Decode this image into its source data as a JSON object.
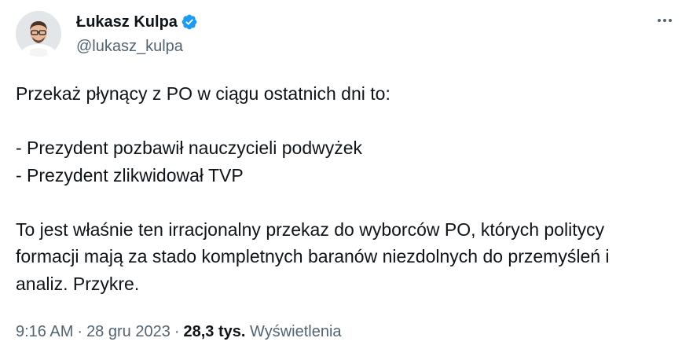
{
  "author": {
    "name": "Łukasz Kulpa",
    "handle": "@lukasz_kulpa",
    "verified": true,
    "verified_color": "#1d9bf0"
  },
  "tweet": {
    "lines": [
      "Przekaż płynący z PO w ciągu ostatnich dni to:",
      "",
      "- Prezydent pozbawił nauczycieli podwyżek",
      "- Prezydent zlikwidował TVP",
      "",
      "To jest właśnie ten irracjonalny przekaz do wyborców PO, których politycy",
      "formacji mają za stado kompletnych baranów niezdolnych do przemyśleń i",
      "analiz. Przykre."
    ]
  },
  "meta": {
    "time": "9:16 AM",
    "separator": "·",
    "date": "28 gru 2023",
    "views_count": "28,3 tys.",
    "views_label": "Wyświetlenia"
  },
  "icons": {
    "more": "more-horizontal-icon",
    "verified": "verified-badge-icon"
  },
  "colors": {
    "text_primary": "#0f1419",
    "text_secondary": "#536471",
    "background": "#ffffff"
  }
}
